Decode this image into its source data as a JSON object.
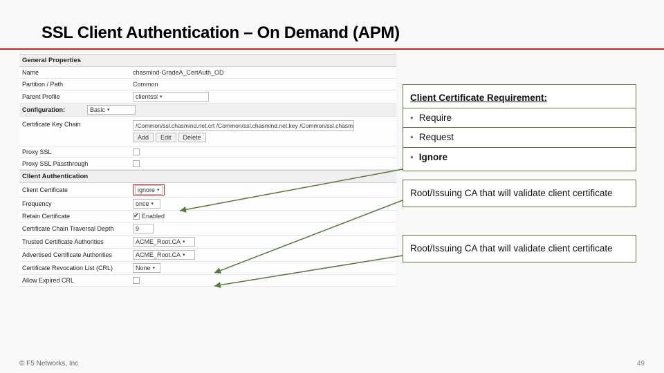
{
  "title": "SSL Client Authentication – On Demand (APM)",
  "sections": {
    "general": "General Properties",
    "client_auth": "Client Authentication"
  },
  "rows": {
    "name_label": "Name",
    "name_value": "chasmind-GradeA_CertAuth_OD",
    "partition_label": "Partition / Path",
    "partition_value": "Common",
    "parent_label": "Parent Profile",
    "parent_value": "clientssl",
    "configuration_label": "Configuration:",
    "configuration_value": "Basic",
    "ckc_label": "Certificate Key Chain",
    "ckc_value": "/Common/ssl.chasmind.net.crt /Common/ssl.chasmind.net.key /Common/ssl.chasmind.net-chain.cr",
    "add_btn": "Add",
    "edit_btn": "Edit",
    "delete_btn": "Delete",
    "proxy_ssl_label": "Proxy SSL",
    "proxy_ssl_pt_label": "Proxy SSL Passthrough",
    "client_cert_label": "Client Certificate",
    "client_cert_value": "ignore",
    "frequency_label": "Frequency",
    "frequency_value": "once",
    "retain_cert_label": "Retain Certificate",
    "retain_enabled": "Enabled",
    "chain_depth_label": "Certificate Chain Traversal Depth",
    "chain_depth_value": "9",
    "trusted_ca_label": "Trusted Certificate Authorities",
    "trusted_ca_value": "ACME_Root.CA",
    "advertised_ca_label": "Advertised Certificate Authorities",
    "advertised_ca_value": "ACME_Root.CA",
    "crl_label": "Certificate Revocation List (CRL)",
    "crl_value": "None",
    "expired_crl_label": "Allow Expired CRL"
  },
  "callout1": {
    "heading": "Client Certificate Requirement:",
    "opt1": "Require",
    "opt2": "Request",
    "opt3": "Ignore"
  },
  "callout2": "Root/Issuing CA that will validate client certificate",
  "callout3": "Root/Issuing CA that will validate client certificate",
  "footer": {
    "left": "© F5 Networks, Inc",
    "right": "49"
  }
}
